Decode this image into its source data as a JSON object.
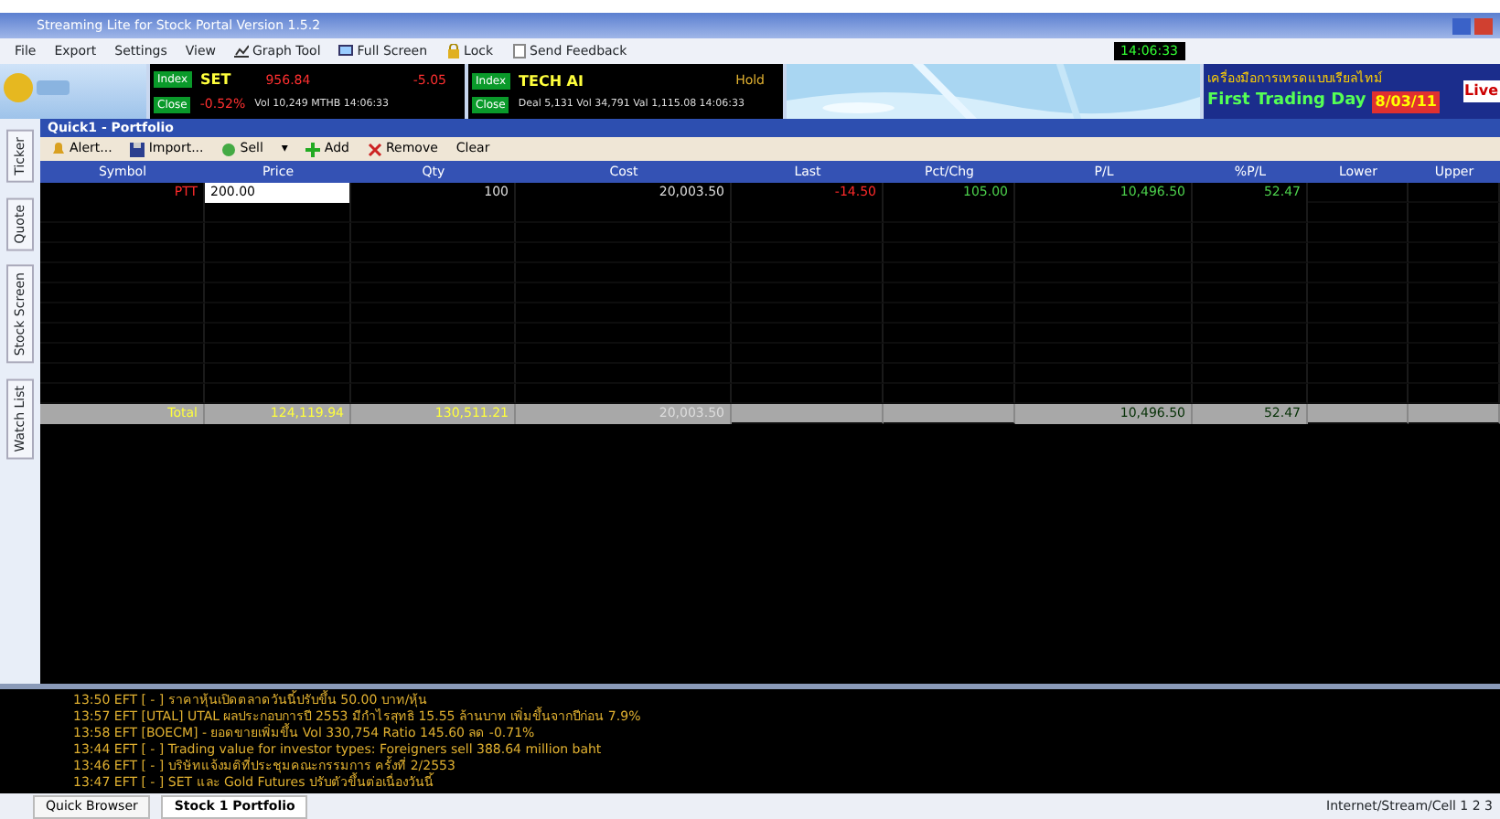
{
  "window": {
    "title": "Streaming Lite for Stock Portal Version 1.5.2"
  },
  "menu": [
    "File",
    "Export",
    "Settings",
    "View",
    "Graph Tool",
    "Full Screen",
    "Lock",
    "Send Feedback"
  ],
  "clock": "14:06:33",
  "tickers": [
    {
      "badge1": "Index",
      "name": "SET",
      "value": "956.84",
      "change": "-5.05",
      "badge2": "Close",
      "sub1": "-0.52%",
      "sub2": "Vol 10,249 MTHB 14:06:33"
    },
    {
      "badge1": "Index",
      "name": "TECH AI",
      "change": "Hold",
      "badge2": "Close",
      "sub2": "Deal 5,131 Vol 34,791 Val 1,115.08 14:06:33"
    }
  ],
  "ad": {
    "line1": "เครื่องมือการเทรดแบบเรียลไทม์",
    "line2": "First Trading Day",
    "badge": "8/03/11",
    "tag": "Live"
  },
  "side_tabs": [
    "Ticker",
    "Quote",
    "Stock Screen",
    "Watch List"
  ],
  "panel": {
    "title": "Quick1 - Portfolio"
  },
  "toolbar": [
    "Alert...",
    "Import...",
    "Sell",
    "▾",
    "Add",
    "Remove",
    "Clear"
  ],
  "table": {
    "columns": [
      "Symbol",
      "Price",
      "Qty",
      "Cost",
      "Last",
      "Pct/Chg",
      "P/L",
      "%P/L",
      "Lower",
      "Upper"
    ],
    "rows": [
      {
        "symbol": "PTT",
        "price": "200.00",
        "qty": "100",
        "cost": "20,003.50",
        "last": "-14.50",
        "pct_chg": "105.00",
        "pl": "10,496.50",
        "pct_pl": "52.47"
      }
    ],
    "total": {
      "symbol": "Total",
      "price": "124,119.94",
      "qty": "130,511.21",
      "cost": "20,003.50",
      "pl": "10,496.50",
      "pct_pl": "52.47"
    }
  },
  "log": [
    "13:50 EFT [ - ] ราคาหุ้นเปิดตลาดวันนี้ปรับขึ้น 50.00 บาท/หุ้น",
    "13:57 EFT [UTAL] UTAL ผลประกอบการปี 2553 มีกำไรสุทธิ 15.55 ล้านบาท เพิ่มขึ้นจากปีก่อน 7.9%",
    "13:58 EFT [BOECM] - ยอดขายเพิ่มขึ้น Vol 330,754 Ratio 145.60 ลด -0.71%",
    "13:44 EFT [ - ] Trading value for investor types: Foreigners sell 388.64 million baht",
    "13:46 EFT [ - ] บริษัทแจ้งมติที่ประชุมคณะกรรมการ ครั้งที่ 2/2553",
    "13:47 EFT [ - ] SET และ Gold Futures ปรับตัวขึ้นต่อเนื่องวันนี้"
  ],
  "taskbar": [
    {
      "label": "Quick Browser",
      "selected": false
    },
    {
      "label": "Stock 1 Portfolio",
      "selected": true
    }
  ],
  "status": "Internet/Stream/Cell 1 2 3"
}
